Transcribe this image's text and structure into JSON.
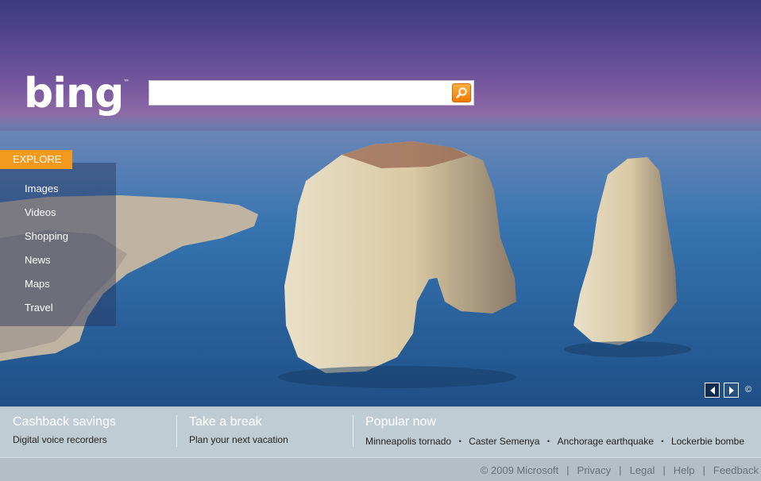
{
  "logo": {
    "text": "bing",
    "tm": "™"
  },
  "search": {
    "value": "",
    "placeholder": ""
  },
  "icons": {
    "search": "magnifier-icon",
    "prev": "arrow-left-icon",
    "next": "arrow-right-icon",
    "copyright": "copyright-icon"
  },
  "explore": {
    "label": "EXPLORE",
    "items": [
      {
        "label": "Images"
      },
      {
        "label": "Videos"
      },
      {
        "label": "Shopping"
      },
      {
        "label": "News"
      },
      {
        "label": "Maps"
      },
      {
        "label": "Travel"
      }
    ]
  },
  "copyright_symbol": "©",
  "bottom": {
    "col1": {
      "head": "Cashback savings",
      "sub": "Digital voice recorders"
    },
    "col2": {
      "head": "Take a break",
      "sub": "Plan your next vacation"
    },
    "col3": {
      "head": "Popular now",
      "items": [
        "Minneapolis tornado",
        "Caster Semenya",
        "Anchorage earthquake",
        "Lockerbie bombe"
      ],
      "separator": "・"
    }
  },
  "footer": {
    "copyright": "© 2009 Microsoft",
    "links": [
      "Privacy",
      "Legal",
      "Help",
      "Feedback"
    ],
    "separator": "|"
  },
  "colors": {
    "accent": "#f39a1c",
    "sky": "#6a4f96",
    "sea": "#2a66a2"
  }
}
